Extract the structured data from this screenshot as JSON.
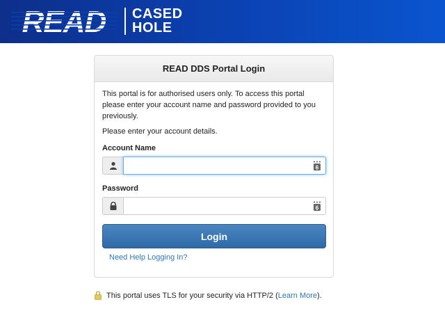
{
  "header": {
    "logo_read": "READ",
    "logo_line1": "CASED",
    "logo_line2": "HOLE",
    "background": "#0b3fae"
  },
  "panel": {
    "title": "READ DDS Portal Login",
    "intro": "This portal is for authorised users only. To access this portal please enter your account name and password provided to you previously.",
    "details": "Please enter your account details.",
    "account": {
      "label": "Account Name",
      "value": "",
      "icon": "user-icon"
    },
    "password": {
      "label": "Password",
      "value": "",
      "icon": "lock-icon"
    },
    "login_label": "Login",
    "login_color": "#3a77b4",
    "help_link": "Need Help Logging In?"
  },
  "footer": {
    "text_before": "This portal uses TLS for your security via HTTP/2 (",
    "learn_more": "Learn More",
    "text_after": ")."
  }
}
